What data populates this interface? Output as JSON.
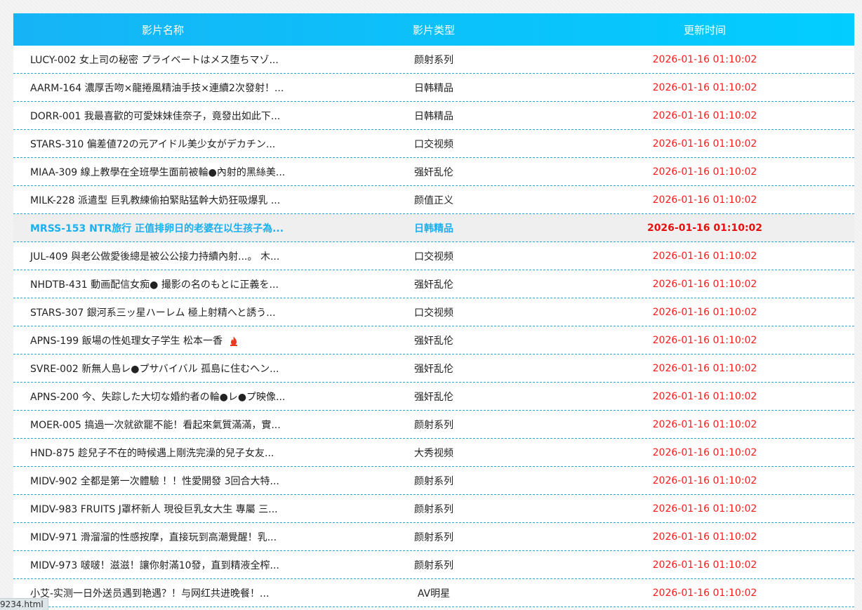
{
  "header": {
    "col_title": "影片名称",
    "col_type": "影片类型",
    "col_time": "更新时间"
  },
  "rows": [
    {
      "title": "LUCY-002 女上司の秘密 プライベートはメス堕ちマゾ...",
      "type": "颜射系列",
      "time": "2026-01-16 01:10:02"
    },
    {
      "title": "AARM-164 濃厚舌吻×龍捲風精油手技×連續2次發射！...",
      "type": "日韩精品",
      "time": "2026-01-16 01:10:02"
    },
    {
      "title": "DORR-001 我最喜歡的可愛妹妹佳奈子，竟發出如此下...",
      "type": "日韩精品",
      "time": "2026-01-16 01:10:02"
    },
    {
      "title": "STARS-310 偏差値72の元アイドル美少女がデカチン...",
      "type": "口交视频",
      "time": "2026-01-16 01:10:02"
    },
    {
      "title": "MIAA-309 線上教學在全班學生面前被輪●內射的黑絲美...",
      "type": "强奸乱伦",
      "time": "2026-01-16 01:10:02"
    },
    {
      "title": "MILK-228 派遣型 巨乳教練偷拍緊貼猛幹大奶狂吸爆乳 ...",
      "type": "颜值正义",
      "time": "2026-01-16 01:10:02"
    },
    {
      "title": "MRSS-153 NTR旅行 正值排卵日的老婆在以生孩子為...",
      "type": "日韩精品",
      "time": "2026-01-16 01:10:02"
    },
    {
      "title": "JUL-409 與老公做愛後總是被公公接力持續內射...。 木...",
      "type": "口交视频",
      "time": "2026-01-16 01:10:02"
    },
    {
      "title": "NHDTB-431 動画配信女痴● 撮影の名のもとに正義を...",
      "type": "强奸乱伦",
      "time": "2026-01-16 01:10:02"
    },
    {
      "title": "STARS-307 銀河系三ッ星ハーレム 極上射精へと誘う...",
      "type": "口交视频",
      "time": "2026-01-16 01:10:02"
    },
    {
      "title": "APNS-199 飯場の性処理女子学生 松本一香",
      "type": "强奸乱伦",
      "time": "2026-01-16 01:10:02"
    },
    {
      "title": "SVRE-002 新無人島レ●プサバイバル 孤島に住むヘン...",
      "type": "强奸乱伦",
      "time": "2026-01-16 01:10:02"
    },
    {
      "title": "APNS-200 今、失踪した大切な婚約者の輪●レ●プ映像...",
      "type": "强奸乱伦",
      "time": "2026-01-16 01:10:02"
    },
    {
      "title": "MOER-005 搞過一次就欲罷不能！看起來氣質滿滿，實...",
      "type": "颜射系列",
      "time": "2026-01-16 01:10:02"
    },
    {
      "title": "HND-875 趁兒子不在的時候遇上剛洗完澡的兒子女友...",
      "type": "大秀视频",
      "time": "2026-01-16 01:10:02"
    },
    {
      "title": "MIDV-902 全都是第一次體驗 ！！性愛開發 3回合大特...",
      "type": "颜射系列",
      "time": "2026-01-16 01:10:02"
    },
    {
      "title": "MIDV-983 FRUITS J罩杯新人 現役巨乳女大生 專屬 三...",
      "type": "颜射系列",
      "time": "2026-01-16 01:10:02"
    },
    {
      "title": "MIDV-971 滑溜溜的性感按摩，直接玩到高潮覺醒！乳...",
      "type": "颜射系列",
      "time": "2026-01-16 01:10:02"
    },
    {
      "title": "MIDV-973 啵啵！滋滋！讓你射滿10發，直到精液全榨...",
      "type": "颜射系列",
      "time": "2026-01-16 01:10:02"
    },
    {
      "title": "小艾-实测一日外送员遇到艳遇？！与网红共进晚餐！...",
      "type": "AV明星",
      "time": "2026-01-16 01:10:02"
    }
  ],
  "active_row_index": 6,
  "hot_icon": {
    "row_index": 10,
    "name": "hot-flame-icon",
    "color": "#e83a1f"
  },
  "status_bar": {
    "url": "9234.html"
  },
  "colors": {
    "header_gradient_start": "#16b4f6",
    "header_gradient_end": "#02cdfe",
    "time_text": "#ff1a1a",
    "active_text": "#1ab0ef",
    "row_divider": "#2aa6d6"
  }
}
